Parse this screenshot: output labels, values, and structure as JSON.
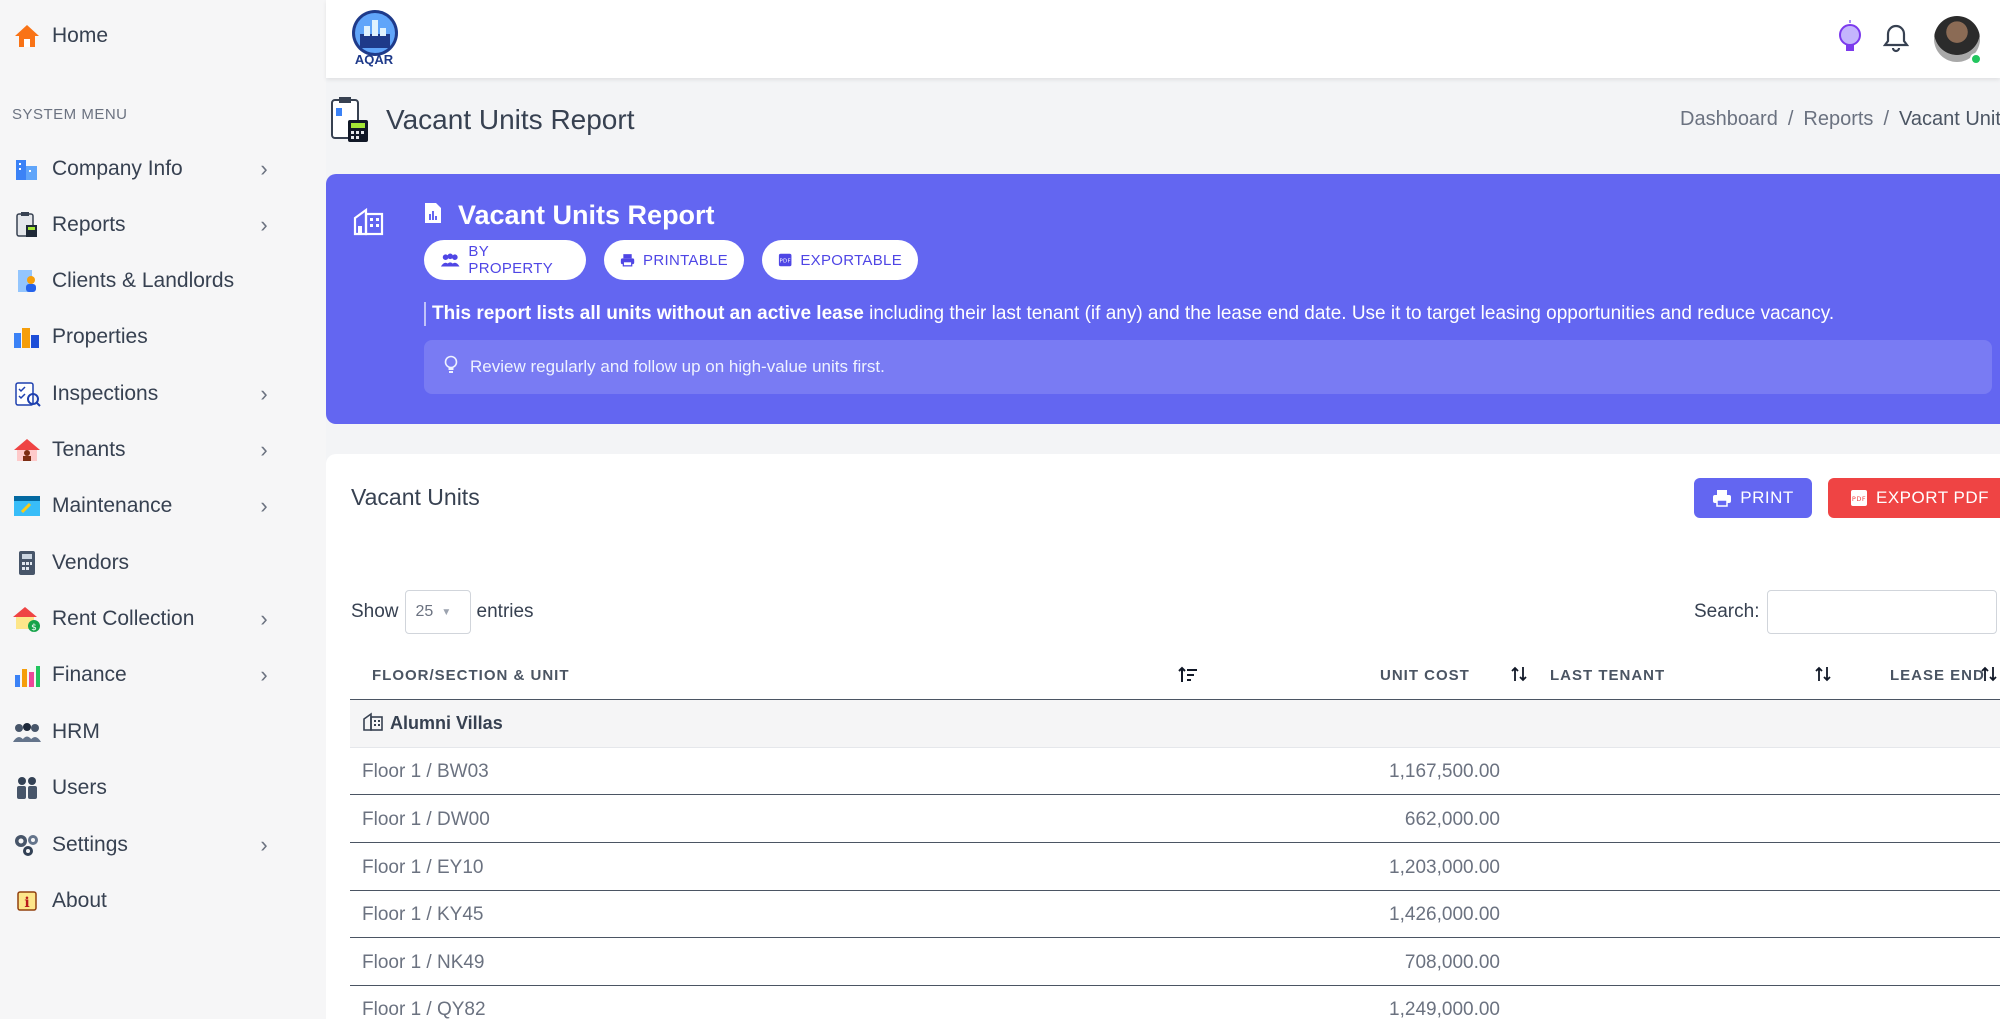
{
  "sidebar": {
    "home": "Home",
    "section_label": "SYSTEM MENU",
    "items": [
      {
        "label": "Company Info",
        "icon": "building-icon",
        "has_children": true
      },
      {
        "label": "Reports",
        "icon": "clipboard-report-icon",
        "has_children": true
      },
      {
        "label": "Clients & Landlords",
        "icon": "person-icon",
        "has_children": false
      },
      {
        "label": "Properties",
        "icon": "city-buildings-icon",
        "has_children": false
      },
      {
        "label": "Inspections",
        "icon": "inspection-checklist-icon",
        "has_children": true
      },
      {
        "label": "Tenants",
        "icon": "house-person-icon",
        "has_children": true
      },
      {
        "label": "Maintenance",
        "icon": "maintenance-window-icon",
        "has_children": true
      },
      {
        "label": "Vendors",
        "icon": "calculator-icon",
        "has_children": false
      },
      {
        "label": "Rent Collection",
        "icon": "house-money-icon",
        "has_children": true
      },
      {
        "label": "Finance",
        "icon": "finance-chart-icon",
        "has_children": true
      },
      {
        "label": "HRM",
        "icon": "team-icon",
        "has_children": false
      },
      {
        "label": "Users",
        "icon": "users-icon",
        "has_children": false
      },
      {
        "label": "Settings",
        "icon": "gears-icon",
        "has_children": true
      },
      {
        "label": "About",
        "icon": "info-icon",
        "has_children": false
      }
    ]
  },
  "header": {
    "logo_text": "AQAR"
  },
  "page": {
    "title": "Vacant Units Report",
    "breadcrumb": [
      "Dashboard",
      "Reports",
      "Vacant Units Report"
    ]
  },
  "banner": {
    "title": "Vacant Units Report",
    "pills": [
      "BY PROPERTY",
      "PRINTABLE",
      "EXPORTABLE"
    ],
    "desc_bold": "This report lists all units without an active lease",
    "desc_rest": " including their last tenant (if any) and the lease end date. Use it to target leasing opportunities and reduce vacancy.",
    "tip": "Review regularly and follow up on high-value units first.",
    "accent": "#6366f1"
  },
  "card": {
    "title": "Vacant Units",
    "print_label": "PRINT",
    "export_label": "EXPORT PDF",
    "show_label": "Show",
    "entries_value": "25",
    "entries_label": "entries",
    "search_label": "Search:",
    "search_value": ""
  },
  "table": {
    "columns": [
      "FLOOR/SECTION & UNIT",
      "UNIT COST",
      "LAST TENANT",
      "LEASE END"
    ],
    "group": "Alumni Villas",
    "rows": [
      {
        "unit": "Floor 1 / BW03",
        "cost": "1,167,500.00"
      },
      {
        "unit": "Floor 1 / DW00",
        "cost": "662,000.00"
      },
      {
        "unit": "Floor 1 / EY10",
        "cost": "1,203,000.00"
      },
      {
        "unit": "Floor 1 / KY45",
        "cost": "1,426,000.00"
      },
      {
        "unit": "Floor 1 / NK49",
        "cost": "708,000.00"
      },
      {
        "unit": "Floor 1 / QY82",
        "cost": "1,249,000.00"
      }
    ]
  }
}
